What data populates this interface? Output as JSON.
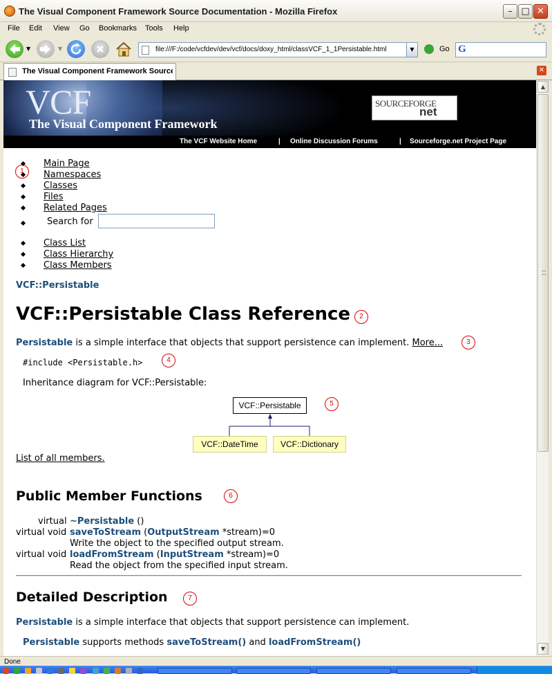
{
  "window": {
    "title": "The Visual Component Framework Source Documentation - Mozilla Firefox"
  },
  "menu": [
    "File",
    "Edit",
    "View",
    "Go",
    "Bookmarks",
    "Tools",
    "Help"
  ],
  "toolbar": {
    "url": "file:///F:/code/vcfdev/dev/vcf/docs/doxy_html/classVCF_1_1Persistable.html",
    "go_label": "Go",
    "search_engine": "G"
  },
  "tab": {
    "title": "The Visual Component Framework Source Documentation"
  },
  "banner": {
    "logo": "VCF",
    "subtitle": "The Visual Component Framework",
    "sourceforge_1": "SOURCEFORGE",
    "sourceforge_2": "net",
    "links": [
      "The VCF Website Home",
      "|",
      "Online Discussion Forums",
      "|",
      "Sourceforge.net Project Page"
    ]
  },
  "nav": {
    "main": [
      "Main Page",
      "Namespaces",
      "Classes",
      "Files",
      "Related Pages"
    ],
    "search_label": "Search for",
    "sub": [
      "Class List",
      "Class Hierarchy",
      "Class Members"
    ]
  },
  "annotations": [
    "1",
    "2",
    "3",
    "4",
    "5",
    "6",
    "7"
  ],
  "doc": {
    "crumb": "VCF::Persistable",
    "title": "VCF::Persistable Class Reference",
    "brief_class": "Persistable",
    "brief_text": " is a simple interface that objects that support persistence can implement. ",
    "more": "More...",
    "include": "#include <Persistable.h>",
    "inheritance": "Inheritance diagram for VCF::Persistable:",
    "diagram": {
      "base": "VCF::Persistable",
      "children": [
        "VCF::DateTime",
        "VCF::Dictionary"
      ]
    },
    "list_all": "List of all members.",
    "public_header": "Public Member Functions",
    "members": [
      {
        "type": "virtual",
        "name": "~Persistable",
        "args_pre": " ()",
        "param_type": "",
        "args_post": "",
        "desc": ""
      },
      {
        "type": "virtual void",
        "name": "saveToStream",
        "args_pre": " (",
        "param_type": "OutputStream",
        "args_post": " *stream)=0",
        "desc": "Write the object to the specified output stream."
      },
      {
        "type": "virtual void",
        "name": "loadFromStream",
        "args_pre": " (",
        "param_type": "InputStream",
        "args_post": " *stream)=0",
        "desc": "Read the object from the specified input stream."
      }
    ],
    "detail_header": "Detailed Description",
    "detail_class": "Persistable",
    "detail_text": " is a simple interface that objects that support persistence can implement.",
    "detail2_class": "Persistable",
    "detail2_mid": " supports methods ",
    "detail2_m1": "saveToStream()",
    "detail2_and": " and ",
    "detail2_m2": "loadFromStream()"
  },
  "status": "Done"
}
